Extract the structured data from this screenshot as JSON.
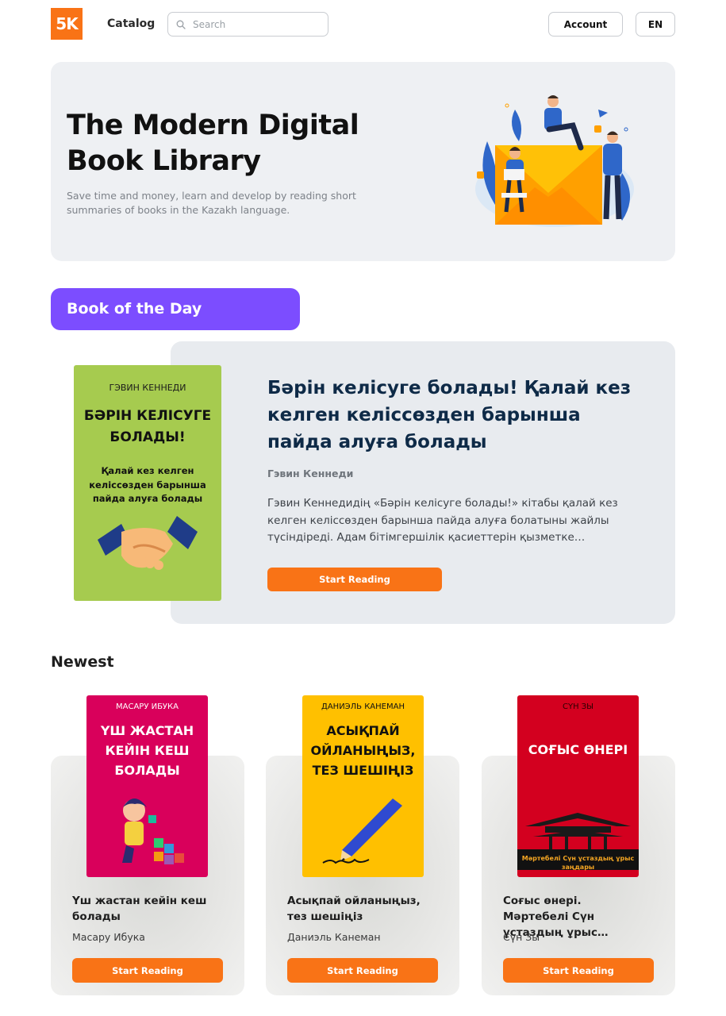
{
  "header": {
    "logo": "5K",
    "catalog": "Catalog",
    "search_placeholder": "Search",
    "account": "Account",
    "lang": "EN"
  },
  "hero": {
    "title": "The Modern Digital Book Library",
    "subtitle": "Save time and money, learn and develop by reading short summaries of books in the Kazakh language."
  },
  "book_of_day": {
    "label": "Book of the Day",
    "cover": {
      "author": "ГЭВИН КЕННЕДИ",
      "title": "БӘРІН КЕЛІСУГЕ БОЛАДЫ!",
      "subtitle": "Қалай кез келген келіссөзден барынша пайда алуға болады"
    },
    "title": "Бәрін келісуге болады! Қалай кез келген келіссөзден барынша пайда алуға болады",
    "author": "Гэвин Кеннеди",
    "description": "Гэвин Кеннедидің «Бәрін келісуге болады!» кітабы қалай кез келген келіссөзден барынша пайда алуға болатыны жайлы түсіндіреді. Адам бітімгершілік қасиеттерін қызметке…",
    "button": "Start Reading"
  },
  "newest": {
    "heading": "Newest",
    "books": [
      {
        "cover_author": "МАСАРУ ИБУКА",
        "cover_title": "ҮШ ЖАСТАН КЕЙІН КЕШ БОЛАДЫ",
        "title": "Үш жастан кейін кеш болады",
        "author": "Масару Ибука",
        "button": "Start Reading",
        "cover_color": "#d9005b"
      },
      {
        "cover_author": "ДАНИЭЛЬ КАНЕМАН",
        "cover_title": "АСЫҚПАЙ ОЙЛАНЫҢЫЗ, ТЕЗ ШЕШІҢІЗ",
        "title": "Асықпай ойланыңыз, тез шешіңіз",
        "author": "Даниэль Канеман",
        "button": "Start Reading",
        "cover_color": "#ffc000"
      },
      {
        "cover_author": "СҮН ЗЫ",
        "cover_title": "СОҒЫС ӨНЕРІ",
        "cover_subtitle": "Мәртебелі Сүн ұстаздың ұрыс заңдары",
        "title": "Соғыс өнері. Мәртебелі Сүн ұстаздың ұрыс…",
        "author": "Сүн Зы",
        "button": "Start Reading",
        "cover_color": "#d3001f"
      }
    ]
  },
  "colors": {
    "accent_orange": "#f97316",
    "accent_purple": "#7c4dff",
    "title_navy": "#0e2a47"
  }
}
